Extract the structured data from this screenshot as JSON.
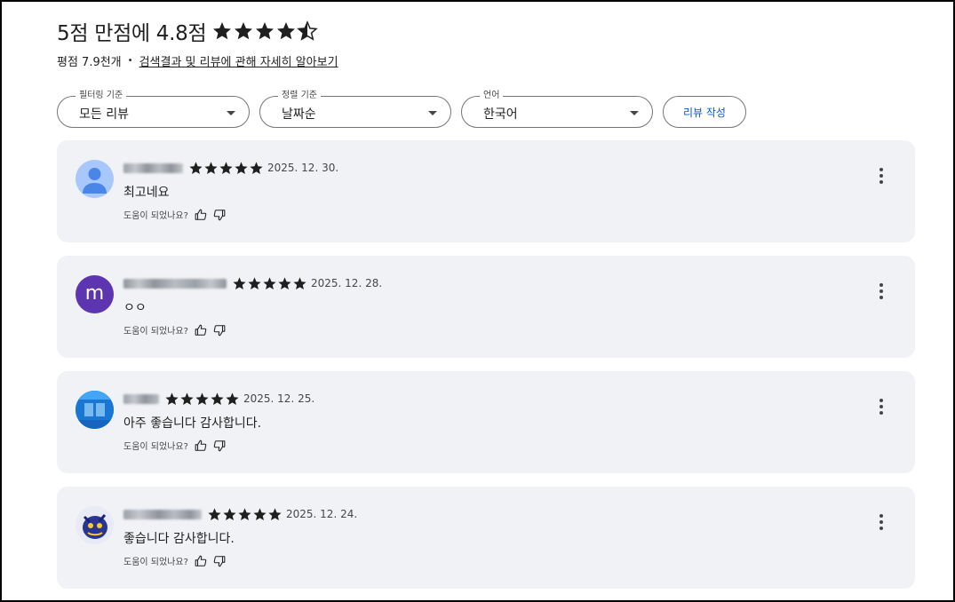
{
  "header": {
    "title": "5점 만점에 4.8점",
    "rating_value": 4.8,
    "rating_count": "평점 7.9천개",
    "learn_more": "검색결과 및 리뷰에 관해 자세히 알아보기"
  },
  "filters": [
    {
      "legend": "필터링 기준",
      "value": "모든 리뷰"
    },
    {
      "legend": "정렬 기준",
      "value": "날짜순"
    },
    {
      "legend": "언어",
      "value": "한국어"
    }
  ],
  "write_review_label": "리뷰 작성",
  "reviews": [
    {
      "date": "2025. 12. 30.",
      "text": "최고네요",
      "rating": 5,
      "helpful_label": "도움이 되었나요?",
      "avatar_icon": "default-person-icon"
    },
    {
      "date": "2025. 12. 28.",
      "text": "ㅇㅇ",
      "rating": 5,
      "helpful_label": "도움이 되었나요?",
      "avatar_letter": "m"
    },
    {
      "date": "2025. 12. 25.",
      "text": "아주 좋습니다 감사합니다.",
      "rating": 5,
      "helpful_label": "도움이 되었나요?",
      "avatar_icon": "photo-avatar"
    },
    {
      "date": "2025. 12. 24.",
      "text": "좋습니다 감사합니다.",
      "rating": 5,
      "helpful_label": "도움이 되었나요?",
      "avatar_icon": "photo-avatar"
    }
  ],
  "colors": {
    "accent": "#0b57d0",
    "card_bg": "#f0f2f5",
    "avatar_purple": "#5e35b1"
  }
}
